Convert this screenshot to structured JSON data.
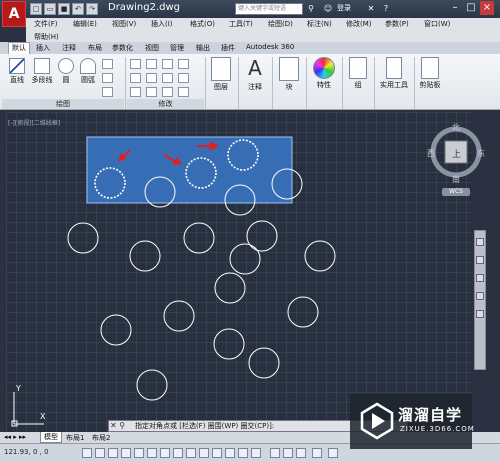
{
  "app": {
    "logo_letter": "A",
    "document_title": "Drawing2.dwg",
    "search_placeholder": "键入关键字或短语",
    "login_label": "登录"
  },
  "menu": {
    "items": [
      "文件(F)",
      "编辑(E)",
      "视图(V)",
      "插入(I)",
      "格式(O)",
      "工具(T)",
      "绘图(D)",
      "标注(N)",
      "修改(M)",
      "参数(P)",
      "窗口(W)"
    ],
    "second_row": [
      "帮助(H)"
    ]
  },
  "ribbon_tabs": [
    "默认",
    "插入",
    "注释",
    "布局",
    "参数化",
    "视图",
    "管理",
    "输出",
    "插件",
    "Autodesk 360"
  ],
  "ribbon": {
    "draw_tools": [
      "直线",
      "多段线",
      "圆",
      "圆弧"
    ],
    "draw_panel_label": "绘图",
    "modify_panel_label": "修改",
    "layers_label": "图层",
    "annotate_label": "注释",
    "block_label": "块",
    "properties_label": "特性",
    "group_label": "组",
    "utilities_label": "实用工具",
    "clipboard_label": "剪贴板"
  },
  "viewport": {
    "label": "[-][俯视][二维线框]",
    "compass": {
      "north": "北",
      "south": "南",
      "west": "西",
      "east": "东",
      "top": "上"
    },
    "wcs_label": "WCS",
    "ucs_y": "Y",
    "ucs_x": "X"
  },
  "command_line": {
    "text": "指定对角点或 [栏选(F) 圈围(WP) 圈交(CP)]:"
  },
  "layout_tabs": [
    "模型",
    "布局1",
    "布局2"
  ],
  "status": {
    "coords": "121.93, 0 , 0"
  },
  "watermark": {
    "name": "溜溜自学",
    "url": "ZIXUE.3D66.COM"
  },
  "colors": {
    "canvas_bg": "#283040",
    "selection_fill": "#3a78c9",
    "circle_stroke": "#ffffff",
    "arrow_red": "#e02020"
  }
}
